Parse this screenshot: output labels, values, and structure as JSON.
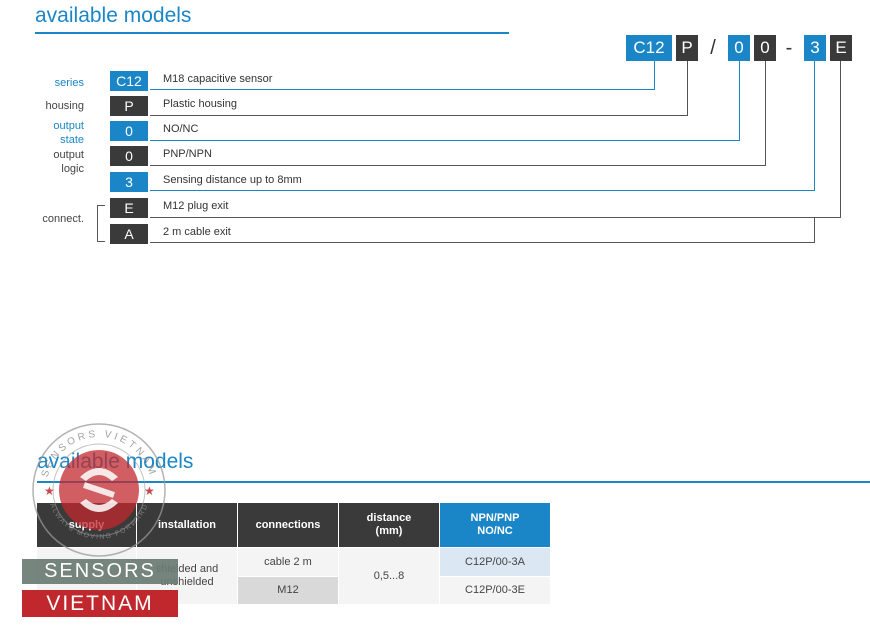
{
  "section1": {
    "title": "available models",
    "code": [
      {
        "text": "C12",
        "color": "blue"
      },
      {
        "text": "P",
        "color": "dark"
      },
      {
        "text": "/",
        "color": "sep"
      },
      {
        "text": "0",
        "color": "blue"
      },
      {
        "text": "0",
        "color": "dark"
      },
      {
        "text": "-",
        "color": "sep"
      },
      {
        "text": "3",
        "color": "blue"
      },
      {
        "text": "E",
        "color": "dark"
      }
    ],
    "rows": [
      {
        "label": "series",
        "code": "C12",
        "desc": "M18 capacitive sensor"
      },
      {
        "label": "housing",
        "code": "P",
        "desc": "Plastic housing"
      },
      {
        "label_l1": "output",
        "label_l2": "state",
        "code": "0",
        "desc": "NO/NC"
      },
      {
        "label_l1": "output",
        "label_l2": "logic",
        "code": "0",
        "desc": "PNP/NPN"
      },
      {
        "code": "3",
        "desc": "Sensing distance up to 8mm"
      },
      {
        "label": "connect.",
        "code": "E",
        "desc": "M12 plug exit"
      },
      {
        "code": "A",
        "desc": "2 m cable exit"
      }
    ]
  },
  "section2": {
    "title": "available models",
    "headers": [
      "supply",
      "installation",
      "connections",
      "distance (mm)",
      "NPN/PNP NO/NC"
    ],
    "header_lines": {
      "distance_l1": "distance",
      "distance_l2": "(mm)",
      "npn_l1": "NPN/PNP",
      "npn_l2": "NO/NC"
    },
    "installation": {
      "l1": "shielded and",
      "l2": "unshielded"
    },
    "connections": [
      "cable 2 m",
      "M12"
    ],
    "distance": "0,5...8",
    "models": [
      "C12P/00-3A",
      "C12P/00-3E"
    ]
  },
  "watermark": {
    "top": "SENSORS",
    "bottom": "VIETNAM",
    "ring_top": "SENSORS VIETNAM",
    "ring_bottom": "ALWAYS MOVING FORWARD"
  },
  "colors": {
    "accent": "#1a86c8",
    "dark": "#3a3a3a",
    "brand_red": "#c0282e"
  }
}
